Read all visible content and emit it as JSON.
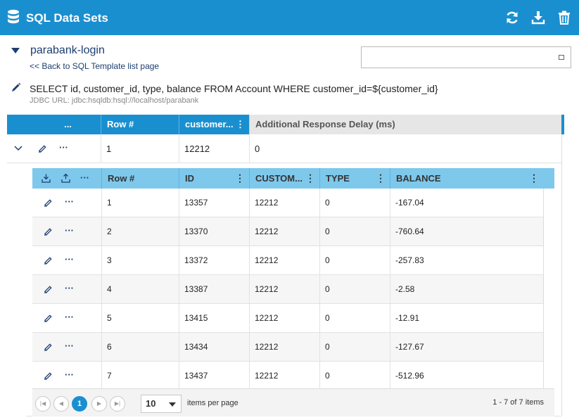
{
  "header": {
    "title": "SQL Data Sets",
    "icons": [
      "database-icon",
      "refresh-icon",
      "download-icon",
      "trash-icon"
    ]
  },
  "dataset": {
    "name": "parabank-login",
    "back_link": "<< Back to SQL Template list page",
    "sql": "SELECT id, customer_id, type, balance FROM Account WHERE customer_id=${customer_id}",
    "jdbc": "JDBC URL: jdbc:hsqldb:hsql://localhost/parabank",
    "search_value": ""
  },
  "outer_table": {
    "actions_header": "...",
    "columns": [
      "Row #",
      "customer...",
      "Additional Response Delay (ms)"
    ],
    "rows": [
      {
        "row": "1",
        "customer": "12212",
        "delay": "0"
      }
    ]
  },
  "inner_table": {
    "columns": [
      "Row #",
      "ID",
      "CUSTOM...",
      "TYPE",
      "BALANCE"
    ],
    "rows": [
      {
        "row": "1",
        "id": "13357",
        "customer": "12212",
        "type": "0",
        "balance": "-167.04"
      },
      {
        "row": "2",
        "id": "13370",
        "customer": "12212",
        "type": "0",
        "balance": "-760.64"
      },
      {
        "row": "3",
        "id": "13372",
        "customer": "12212",
        "type": "0",
        "balance": "-257.83"
      },
      {
        "row": "4",
        "id": "13387",
        "customer": "12212",
        "type": "0",
        "balance": "-2.58"
      },
      {
        "row": "5",
        "id": "13415",
        "customer": "12212",
        "type": "0",
        "balance": "-12.91"
      },
      {
        "row": "6",
        "id": "13434",
        "customer": "12212",
        "type": "0",
        "balance": "-127.67"
      },
      {
        "row": "7",
        "id": "13437",
        "customer": "12212",
        "type": "0",
        "balance": "-512.96"
      }
    ]
  },
  "pager": {
    "current_page": "1",
    "per_page": "10",
    "per_page_label": "items per page",
    "info": "1 - 7 of 7 items"
  },
  "colors": {
    "header_bg": "#1a8fd0",
    "inner_header_bg": "#7ec8ec",
    "link": "#1b3e6f"
  }
}
